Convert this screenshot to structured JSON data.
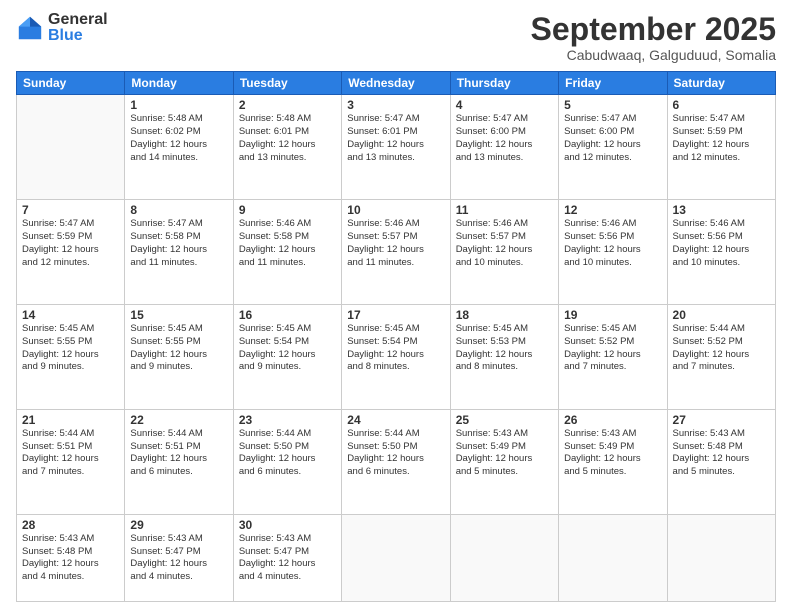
{
  "logo": {
    "general": "General",
    "blue": "Blue"
  },
  "title": "September 2025",
  "subtitle": "Cabudwaaq, Galguduud, Somalia",
  "days_header": [
    "Sunday",
    "Monday",
    "Tuesday",
    "Wednesday",
    "Thursday",
    "Friday",
    "Saturday"
  ],
  "weeks": [
    [
      {
        "day": "",
        "info": ""
      },
      {
        "day": "1",
        "info": "Sunrise: 5:48 AM\nSunset: 6:02 PM\nDaylight: 12 hours\nand 14 minutes."
      },
      {
        "day": "2",
        "info": "Sunrise: 5:48 AM\nSunset: 6:01 PM\nDaylight: 12 hours\nand 13 minutes."
      },
      {
        "day": "3",
        "info": "Sunrise: 5:47 AM\nSunset: 6:01 PM\nDaylight: 12 hours\nand 13 minutes."
      },
      {
        "day": "4",
        "info": "Sunrise: 5:47 AM\nSunset: 6:00 PM\nDaylight: 12 hours\nand 13 minutes."
      },
      {
        "day": "5",
        "info": "Sunrise: 5:47 AM\nSunset: 6:00 PM\nDaylight: 12 hours\nand 12 minutes."
      },
      {
        "day": "6",
        "info": "Sunrise: 5:47 AM\nSunset: 5:59 PM\nDaylight: 12 hours\nand 12 minutes."
      }
    ],
    [
      {
        "day": "7",
        "info": "Sunrise: 5:47 AM\nSunset: 5:59 PM\nDaylight: 12 hours\nand 12 minutes."
      },
      {
        "day": "8",
        "info": "Sunrise: 5:47 AM\nSunset: 5:58 PM\nDaylight: 12 hours\nand 11 minutes."
      },
      {
        "day": "9",
        "info": "Sunrise: 5:46 AM\nSunset: 5:58 PM\nDaylight: 12 hours\nand 11 minutes."
      },
      {
        "day": "10",
        "info": "Sunrise: 5:46 AM\nSunset: 5:57 PM\nDaylight: 12 hours\nand 11 minutes."
      },
      {
        "day": "11",
        "info": "Sunrise: 5:46 AM\nSunset: 5:57 PM\nDaylight: 12 hours\nand 10 minutes."
      },
      {
        "day": "12",
        "info": "Sunrise: 5:46 AM\nSunset: 5:56 PM\nDaylight: 12 hours\nand 10 minutes."
      },
      {
        "day": "13",
        "info": "Sunrise: 5:46 AM\nSunset: 5:56 PM\nDaylight: 12 hours\nand 10 minutes."
      }
    ],
    [
      {
        "day": "14",
        "info": "Sunrise: 5:45 AM\nSunset: 5:55 PM\nDaylight: 12 hours\nand 9 minutes."
      },
      {
        "day": "15",
        "info": "Sunrise: 5:45 AM\nSunset: 5:55 PM\nDaylight: 12 hours\nand 9 minutes."
      },
      {
        "day": "16",
        "info": "Sunrise: 5:45 AM\nSunset: 5:54 PM\nDaylight: 12 hours\nand 9 minutes."
      },
      {
        "day": "17",
        "info": "Sunrise: 5:45 AM\nSunset: 5:54 PM\nDaylight: 12 hours\nand 8 minutes."
      },
      {
        "day": "18",
        "info": "Sunrise: 5:45 AM\nSunset: 5:53 PM\nDaylight: 12 hours\nand 8 minutes."
      },
      {
        "day": "19",
        "info": "Sunrise: 5:45 AM\nSunset: 5:52 PM\nDaylight: 12 hours\nand 7 minutes."
      },
      {
        "day": "20",
        "info": "Sunrise: 5:44 AM\nSunset: 5:52 PM\nDaylight: 12 hours\nand 7 minutes."
      }
    ],
    [
      {
        "day": "21",
        "info": "Sunrise: 5:44 AM\nSunset: 5:51 PM\nDaylight: 12 hours\nand 7 minutes."
      },
      {
        "day": "22",
        "info": "Sunrise: 5:44 AM\nSunset: 5:51 PM\nDaylight: 12 hours\nand 6 minutes."
      },
      {
        "day": "23",
        "info": "Sunrise: 5:44 AM\nSunset: 5:50 PM\nDaylight: 12 hours\nand 6 minutes."
      },
      {
        "day": "24",
        "info": "Sunrise: 5:44 AM\nSunset: 5:50 PM\nDaylight: 12 hours\nand 6 minutes."
      },
      {
        "day": "25",
        "info": "Sunrise: 5:43 AM\nSunset: 5:49 PM\nDaylight: 12 hours\nand 5 minutes."
      },
      {
        "day": "26",
        "info": "Sunrise: 5:43 AM\nSunset: 5:49 PM\nDaylight: 12 hours\nand 5 minutes."
      },
      {
        "day": "27",
        "info": "Sunrise: 5:43 AM\nSunset: 5:48 PM\nDaylight: 12 hours\nand 5 minutes."
      }
    ],
    [
      {
        "day": "28",
        "info": "Sunrise: 5:43 AM\nSunset: 5:48 PM\nDaylight: 12 hours\nand 4 minutes."
      },
      {
        "day": "29",
        "info": "Sunrise: 5:43 AM\nSunset: 5:47 PM\nDaylight: 12 hours\nand 4 minutes."
      },
      {
        "day": "30",
        "info": "Sunrise: 5:43 AM\nSunset: 5:47 PM\nDaylight: 12 hours\nand 4 minutes."
      },
      {
        "day": "",
        "info": ""
      },
      {
        "day": "",
        "info": ""
      },
      {
        "day": "",
        "info": ""
      },
      {
        "day": "",
        "info": ""
      }
    ]
  ]
}
